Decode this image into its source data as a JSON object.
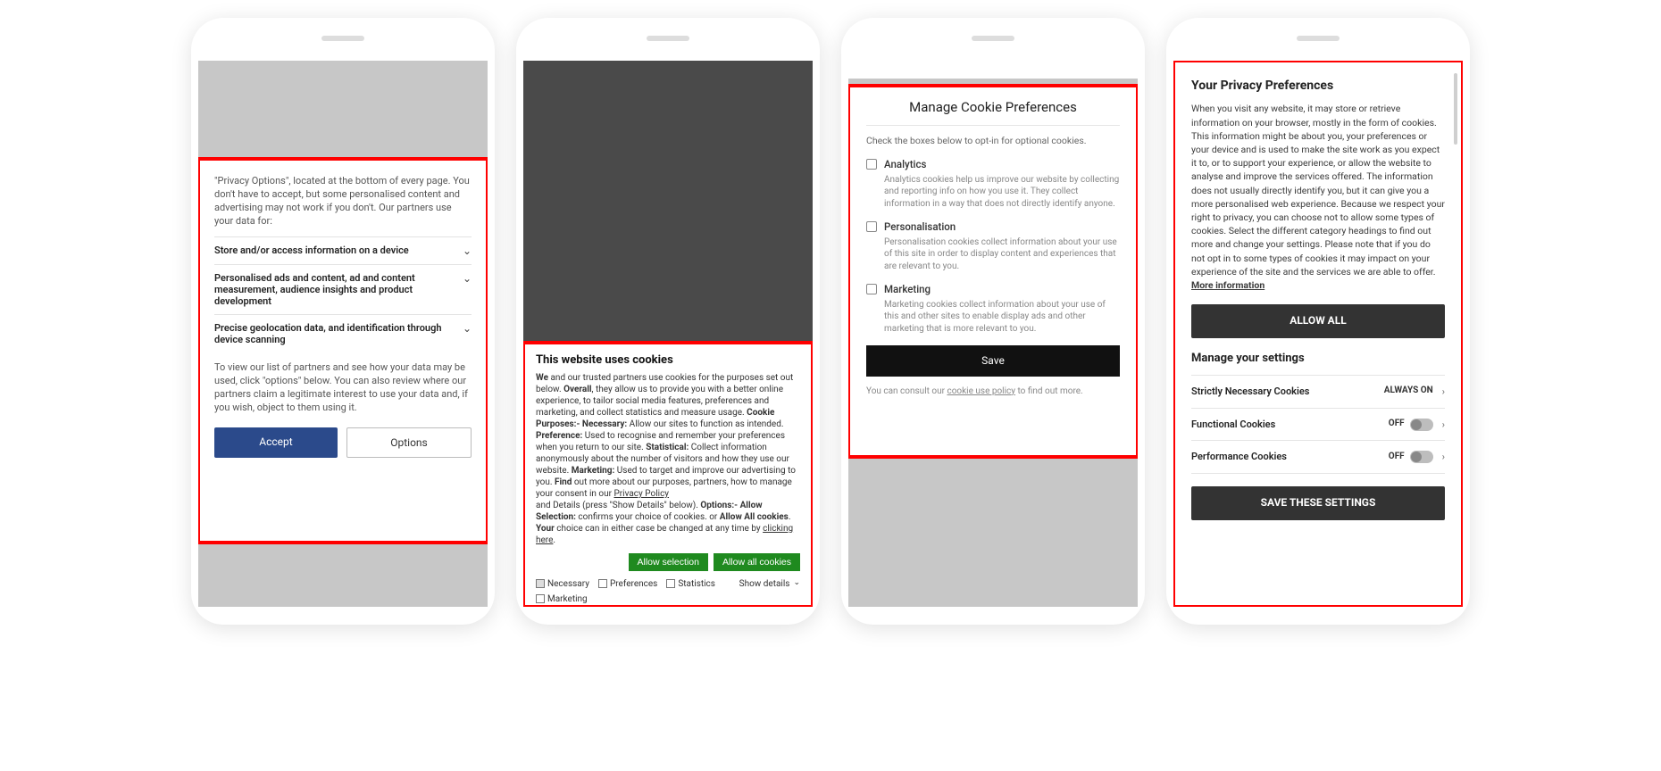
{
  "phone1": {
    "intro": "\"Privacy Options\", located at the bottom of every page. You don't have to accept, but some personalised content and advertising may not work if you don't. Our partners use your data for:",
    "rows": [
      "Store and/or access information on a device",
      "Personalised ads and content, ad and content measurement, audience insights and product development",
      "Precise geolocation data, and identification through device scanning"
    ],
    "footer": "To view our list of partners and see how your data may be used, click \"options\" below. You can also review where our partners claim a legitimate interest to use your data and, if you wish, object to them using it.",
    "accept": "Accept",
    "options": "Options"
  },
  "phone2": {
    "title": "This website uses cookies",
    "body_html": "<b>We</b> and our trusted partners use cookies for the purposes set out below. <b>Overall</b>, they allow us to provide you with a better online experience, to tailor social media features, preferences and marketing, and collect statistics and measure usage. <b>Cookie Purposes:- Necessary:</b> Allow our sites to function as intended. <b>Preference:</b> Used to recognise and remember your preferences when you return to our site. <b>Statistical:</b> Collect information anonymously about the number of visitors and how they use our website. <b>Marketing:</b> Used to target and improve our advertising to you. <b>Find</b> out more about our purposes, partners, how to manage your consent in our <span class='link'>Privacy Policy</span><br>and Details (press \"Show Details\" below). <b>Options:- Allow Selection:</b> confirms your choice of cookies. or <b>Allow All cookies</b>. <b>Your</b> choice can in either case be changed at any time by <span class='link'>clicking here</span>.",
    "allow_selection": "Allow selection",
    "allow_all": "Allow all cookies",
    "checks": [
      {
        "label": "Necessary",
        "checked": true
      },
      {
        "label": "Preferences",
        "checked": false
      },
      {
        "label": "Statistics",
        "checked": false
      },
      {
        "label": "Marketing",
        "checked": false
      }
    ],
    "show_details": "Show details"
  },
  "phone3": {
    "title": "Manage Cookie Preferences",
    "lead": "Check the boxes below to opt-in for optional cookies.",
    "cats": [
      {
        "title": "Analytics",
        "desc": "Analytics cookies help us improve our website by collecting and reporting info on how you use it. They collect information in a way that does not directly identify anyone."
      },
      {
        "title": "Personalisation",
        "desc": "Personalisation cookies collect information about your use of this site in order to display content and experiences that are relevant to you."
      },
      {
        "title": "Marketing",
        "desc": "Marketing cookies collect information about your use of this and other sites to enable display ads and other marketing that is more relevant to you."
      }
    ],
    "save": "Save",
    "policy_pre": "You can consult our ",
    "policy_link": "cookie use policy",
    "policy_post": " to find out more."
  },
  "phone4": {
    "title": "Your Privacy Preferences",
    "body": "When you visit any website, it may store or retrieve information on your browser, mostly in the form of cookies. This information might be about you, your preferences or your device and is used to make the site work as you expect it to, or to support your experience, or allow the website to analyse and improve the services offered. The information does not usually directly identify you, but it can give you a more personalised web experience. Because we respect your right to privacy, you can choose not to allow some types of cookies. Select the different category headings to find out more and change your settings. Please note that if you do not opt in to some types of cookies it may impact on your experience of the site and the services we are able to offer.  ",
    "more": "More information",
    "allow_all": "ALLOW ALL",
    "manage_heading": "Manage your settings",
    "rows": [
      {
        "label": "Strictly Necessary Cookies",
        "status": "ALWAYS ON",
        "toggle": false
      },
      {
        "label": "Functional Cookies",
        "status": "OFF",
        "toggle": true
      },
      {
        "label": "Performance Cookies",
        "status": "OFF",
        "toggle": true
      }
    ],
    "save": "SAVE THESE SETTINGS"
  }
}
